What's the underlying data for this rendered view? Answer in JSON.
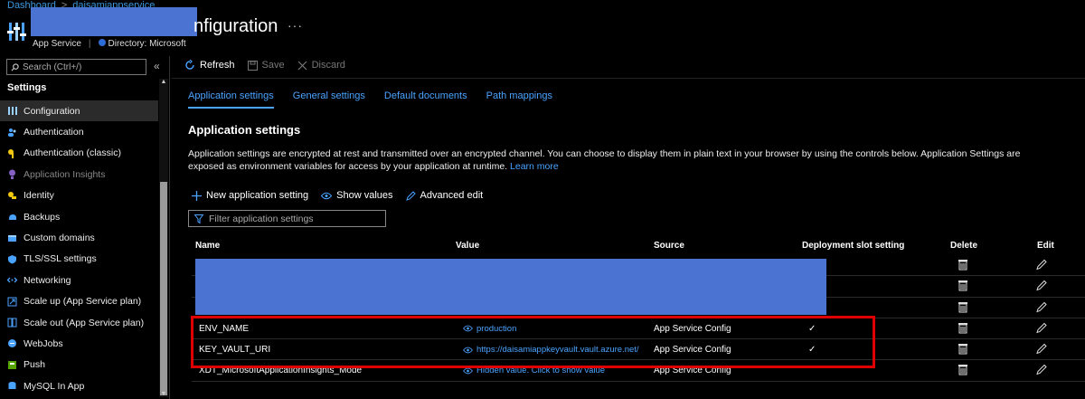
{
  "header": {
    "breadcrumb": [
      "Dashboard",
      ">",
      "daisamiappservice"
    ],
    "title": "nfiguration",
    "more": "···",
    "resource_type": "App Service",
    "directory": "Directory: Microsoft"
  },
  "sidebar": {
    "search_placeholder": "Search (Ctrl+/)",
    "collapse": "«",
    "section": "Settings",
    "items": [
      {
        "label": "Configuration",
        "icon": "config-icon",
        "color": "#9ad0ff"
      },
      {
        "label": "Authentication",
        "icon": "people-icon",
        "color": "#4aa3ff"
      },
      {
        "label": "Authentication (classic)",
        "icon": "key-icon",
        "color": "#f2c811"
      },
      {
        "label": "Application Insights",
        "icon": "insights-icon",
        "color": "#8661c5"
      },
      {
        "label": "Identity",
        "icon": "identity-icon",
        "color": "#f2c811"
      },
      {
        "label": "Backups",
        "icon": "backup-icon",
        "color": "#4aa3ff"
      },
      {
        "label": "Custom domains",
        "icon": "domain-icon",
        "color": "#4aa3ff"
      },
      {
        "label": "TLS/SSL settings",
        "icon": "shield-icon",
        "color": "#4aa3ff"
      },
      {
        "label": "Networking",
        "icon": "network-icon",
        "color": "#4aa3ff"
      },
      {
        "label": "Scale up (App Service plan)",
        "icon": "scale-up-icon",
        "color": "#4aa3ff"
      },
      {
        "label": "Scale out (App Service plan)",
        "icon": "scale-out-icon",
        "color": "#4aa3ff"
      },
      {
        "label": "WebJobs",
        "icon": "webjobs-icon",
        "color": "#4aa3ff"
      },
      {
        "label": "Push",
        "icon": "push-icon",
        "color": "#57a300"
      },
      {
        "label": "MySQL In App",
        "icon": "mysql-icon",
        "color": "#4aa3ff"
      }
    ]
  },
  "toolbar": {
    "refresh": "Refresh",
    "save": "Save",
    "discard": "Discard"
  },
  "tabs": [
    "Application settings",
    "General settings",
    "Default documents",
    "Path mappings"
  ],
  "section_title": "Application settings",
  "description": "Application settings are encrypted at rest and transmitted over an encrypted channel. You can choose to display them in plain text in your browser by using the controls below. Application Settings are exposed as environment variables for access by your application at runtime.",
  "learn_more": "Learn more",
  "commands": {
    "new": "New application setting",
    "show": "Show values",
    "advanced": "Advanced edit"
  },
  "filter_placeholder": "Filter application settings",
  "columns": {
    "name": "Name",
    "value": "Value",
    "source": "Source",
    "slot": "Deployment slot setting",
    "delete": "Delete",
    "edit": "Edit"
  },
  "rows": [
    {
      "name": "",
      "value": "",
      "source": "",
      "slot": ""
    },
    {
      "name": "",
      "value": "",
      "source": "",
      "slot": ""
    },
    {
      "name": "",
      "value": "",
      "source": "",
      "slot": ""
    },
    {
      "name": "ENV_NAME",
      "value": "production",
      "source": "App Service Config",
      "slot": "✓"
    },
    {
      "name": "KEY_VAULT_URI",
      "value": "https://daisamiappkeyvault.vault.azure.net/",
      "source": "App Service Config",
      "slot": "✓"
    },
    {
      "name": "XDT_MicrosoftApplicationInsights_Mode",
      "value": "Hidden value. Click to show value",
      "source": "App Service Config",
      "slot": ""
    }
  ],
  "colors": {
    "accent": "#4aa3ff",
    "highlight": "#e00000",
    "redaction": "#4b73d1"
  }
}
